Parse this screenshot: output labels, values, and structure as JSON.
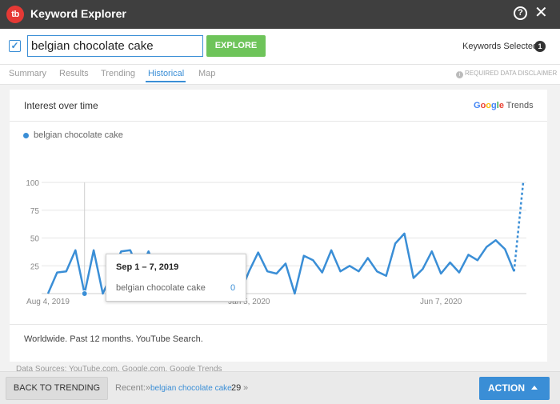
{
  "window": {
    "logo": "tb",
    "title": "Keyword Explorer",
    "help": "?",
    "close": "✕"
  },
  "search": {
    "checked": "✓",
    "query": "belgian chocolate cake",
    "explore_label": "EXPLORE",
    "keywords_selected_label": "Keywords Selected",
    "keywords_selected_count": "1"
  },
  "tabs": [
    "Summary",
    "Results",
    "Trending",
    "Historical",
    "Map"
  ],
  "active_tab": "Historical",
  "disclaimer": "REQUIRED DATA DISCLAIMER",
  "card": {
    "title": "Interest over time",
    "brand": {
      "G1": "G",
      "o1": "o",
      "o2": "o",
      "g": "g",
      "l": "l",
      "e": "e",
      "rest": " Trends"
    },
    "legend": "belgian chocolate cake"
  },
  "tooltip": {
    "date": "Sep 1 – 7, 2019",
    "series": "belgian chocolate cake",
    "value": "0"
  },
  "footnote": "Worldwide. Past 12 months. YouTube Search.",
  "datasource": "Data Sources: YouTube.com, Google.com, Google Trends",
  "footer": {
    "back_label": "BACK TO TRENDING",
    "recent_label": "Recent:»",
    "recent_link": "belgian chocolate cake",
    "recent_count": "29",
    "recent_more": "»",
    "action_label": "ACTION"
  },
  "colors": {
    "series": "#3a8ed6",
    "brand_g_blue": "#4285F4",
    "brand_red": "#EA4335",
    "brand_yellow": "#FBBC05",
    "brand_green": "#34A853"
  },
  "chart_data": {
    "type": "line",
    "series": [
      {
        "name": "belgian chocolate cake",
        "values": [
          0,
          19,
          20,
          39,
          0,
          39,
          0,
          18,
          38,
          39,
          20,
          38,
          18,
          20,
          0,
          28,
          20,
          20,
          20,
          28,
          0,
          0,
          20,
          37,
          20,
          18,
          27,
          0,
          34,
          30,
          19,
          39,
          20,
          25,
          20,
          32,
          20,
          16,
          45,
          54,
          14,
          22,
          38,
          18,
          28,
          19,
          35,
          30,
          42,
          48,
          40,
          20,
          100
        ],
        "last_point_partial": true
      }
    ],
    "x_tick_labels": [
      "Aug 4, 2019",
      "Jan 5, 2020",
      "Jun 7, 2020"
    ],
    "y_ticks": [
      25,
      50,
      75,
      100
    ],
    "ylim": [
      0,
      100
    ],
    "highlighted_index": 4,
    "grid": true
  }
}
